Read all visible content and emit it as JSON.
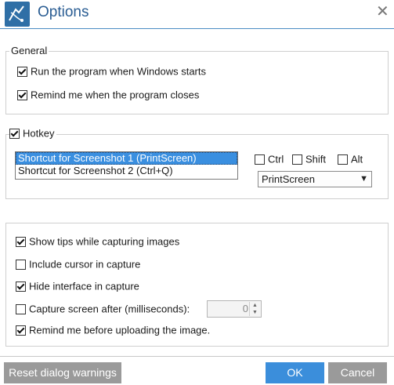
{
  "window": {
    "title": "Options",
    "close_glyph": "✕"
  },
  "general": {
    "legend": "General",
    "run_on_startup": {
      "label": "Run the program when Windows starts",
      "checked": true
    },
    "remind_on_close": {
      "label": "Remind me when the program closes",
      "checked": true
    }
  },
  "hotkey": {
    "label": "Hotkey",
    "enabled": true,
    "shortcuts": [
      {
        "label": "Shortcut for Screenshot 1 (PrintScreen)",
        "selected": true
      },
      {
        "label": "Shortcut for Screenshot 2 (Ctrl+Q)",
        "selected": false
      }
    ],
    "modifiers": {
      "ctrl": {
        "label": "Ctrl",
        "checked": false
      },
      "shift": {
        "label": "Shift",
        "checked": false
      },
      "alt": {
        "label": "Alt",
        "checked": false
      }
    },
    "key_select": {
      "value": "PrintScreen"
    }
  },
  "capture": {
    "show_tips": {
      "label": "Show tips while capturing images",
      "checked": true
    },
    "include_cursor": {
      "label": "Include cursor in capture",
      "checked": false
    },
    "hide_interface": {
      "label": "Hide interface in capture",
      "checked": true
    },
    "delay": {
      "label": "Capture screen after (milliseconds):",
      "checked": false,
      "value": "0"
    },
    "remind_upload": {
      "label": "Remind me before uploading the image.",
      "checked": true
    }
  },
  "buttons": {
    "reset": "Reset dialog warnings",
    "ok": "OK",
    "cancel": "Cancel"
  },
  "colors": {
    "accent": "#3b8edb",
    "title": "#2a5d93",
    "selection": "#3a8fe0"
  }
}
